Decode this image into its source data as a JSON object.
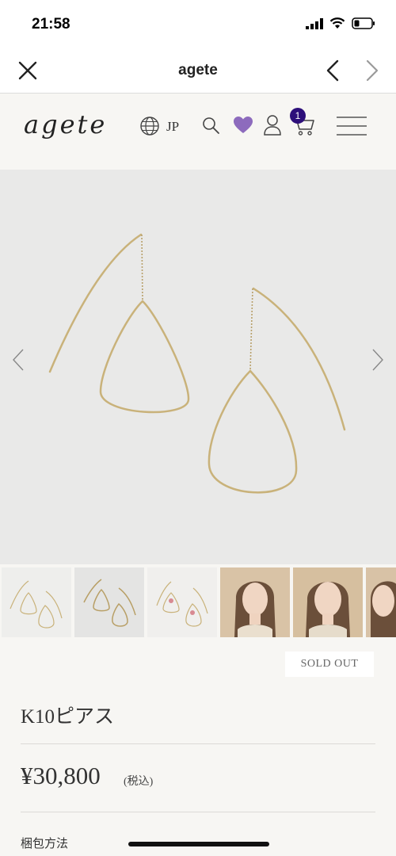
{
  "status_bar": {
    "time": "21:58"
  },
  "browser": {
    "title": "agete"
  },
  "header": {
    "logo": "agete",
    "language": "JP",
    "cart_count": "1"
  },
  "product": {
    "status": "SOLD OUT",
    "name": "K10ピアス",
    "price": "¥30,800",
    "tax_note": "(税込)",
    "section_packaging": "梱包方法"
  },
  "colors": {
    "badge": "#2d0f7a",
    "heart": "#8d6bbd",
    "gold": "#c9b27a"
  }
}
